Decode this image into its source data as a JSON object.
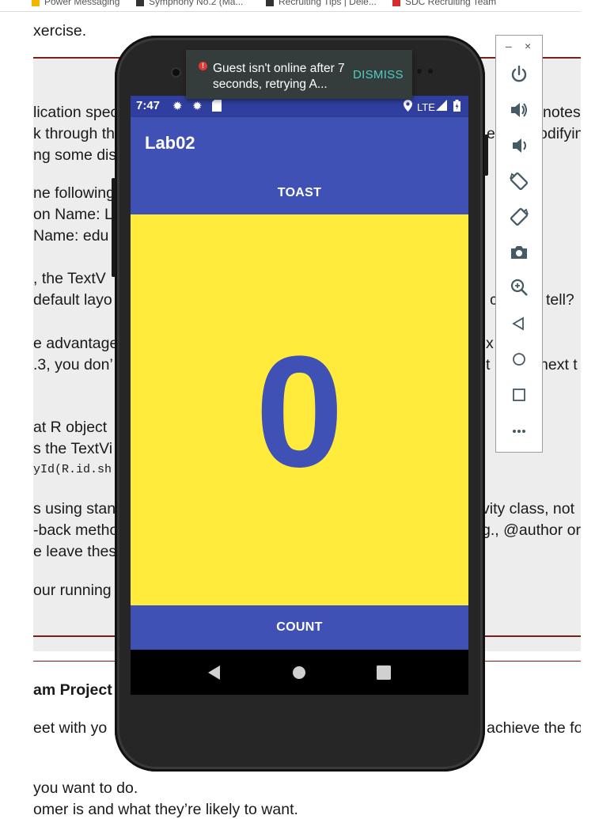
{
  "bookmarks": [
    {
      "label": "Power Messaging",
      "color": "#f4b400"
    },
    {
      "label": "Symphony No.2 (Ma...",
      "color": "#333333"
    },
    {
      "label": "Recruiting Tips | Dele...",
      "color": "#333333"
    },
    {
      "label": "SDC Recruiting Team",
      "color": "#d32f2f"
    }
  ],
  "document": {
    "lines": [
      "xercise.",
      "lication spec",
      "notes",
      "k through th",
      "e",
      "odifyin",
      "ng some dist",
      "ne following",
      "on Name: La",
      "Name: edu",
      ", the TextV",
      "default layo",
      "c",
      "tell?",
      "e advantage",
      "x",
      ".3, you don’",
      "t",
      "next t",
      "at R object",
      "s the TextVi",
      "yId(R.id.sh",
      "s using stan",
      "vity class, not",
      "-back metho",
      "g., @author or",
      "e leave thes",
      "our running",
      "am Project",
      "eet with yo",
      "achieve the fo",
      "you want to do.",
      "omer is and what they’re likely to want."
    ]
  },
  "emulator": {
    "status_time": "7:47",
    "network": "LTE",
    "app_title": "Lab02",
    "toast_label": "TOAST",
    "count_value": "0",
    "count_label": "COUNT",
    "snackbar_message": "Guest isn't online after 7 seconds, retrying A...",
    "snackbar_action": "DISMISS"
  },
  "toolbar": {
    "minimize_label": "–",
    "close_label": "×",
    "tools": [
      "power-icon",
      "volume-up-icon",
      "volume-down-icon",
      "rotate-left-icon",
      "rotate-right-icon",
      "camera-icon",
      "zoom-icon",
      "back-icon",
      "home-icon",
      "overview-icon",
      "more-icon"
    ]
  },
  "colors": {
    "primary": "#3f51b5",
    "primary_dark": "#303f9f",
    "count_background": "#ffeb3b",
    "snackbar_action": "#4dd0c1"
  }
}
